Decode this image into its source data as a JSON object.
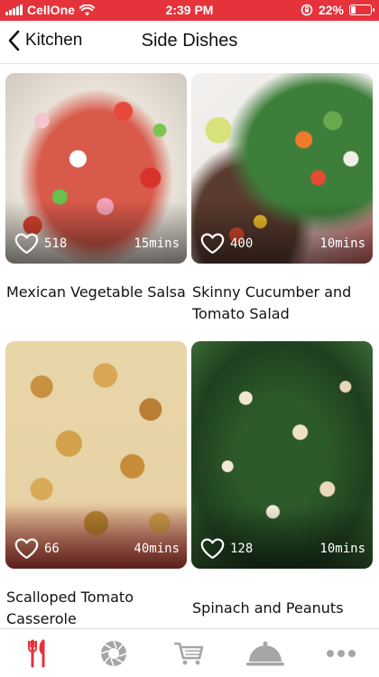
{
  "status_bar": {
    "carrier": "CellOne",
    "time": "2:39 PM",
    "battery_text": "22%",
    "battery_level": 0.22
  },
  "nav": {
    "back_label": "Kitchen",
    "title": "Side Dishes"
  },
  "recipes": [
    {
      "title": "Mexican Vegetable Salsa",
      "likes": "518",
      "time": "15mins"
    },
    {
      "title": "Skinny Cucumber and Tomato Salad",
      "likes": "400",
      "time": "10mins"
    },
    {
      "title": "Scalloped Tomato Casserole",
      "likes": "66",
      "time": "40mins"
    },
    {
      "title": "Spinach and Peanuts",
      "likes": "128",
      "time": "10mins"
    }
  ],
  "tab_bar": {
    "tabs": [
      {
        "icon": "fork-knife-icon",
        "active": true
      },
      {
        "icon": "camera-aperture-icon",
        "active": false
      },
      {
        "icon": "shopping-cart-icon",
        "active": false
      },
      {
        "icon": "cloche-icon",
        "active": false
      },
      {
        "icon": "more-dots-icon",
        "active": false
      }
    ]
  },
  "colors": {
    "accent": "#e6323b",
    "tab_inactive": "#a6a6a6"
  }
}
